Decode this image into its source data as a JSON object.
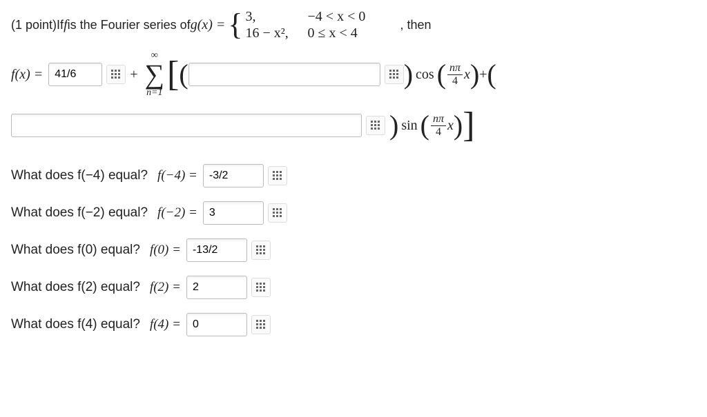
{
  "problem": {
    "points_label": "(1 point)",
    "intro_prefix": " If ",
    "f_sym": "f",
    "intro_mid": " is the Fourier series of ",
    "g_expr": "g(x) = ",
    "case1_val": "3,",
    "case1_cond": "−4 < x < 0",
    "case2_val": "16 − x²,",
    "case2_cond": "0 ≤ x < 4",
    "then_label": ", then"
  },
  "fourier": {
    "fx_equals": "f(x) =",
    "a0_value": "41/6",
    "plus": "+",
    "sum_top": "∞",
    "sum_bottom": "n=1",
    "cos_label": "cos",
    "sin_label": "sin",
    "frac_num": "nπ",
    "frac_den": "4",
    "x_sym": "x",
    "plus2": " + "
  },
  "questions": [
    {
      "label": "What does f(−4) equal?",
      "feq": "f(−4) = ",
      "value": "-3/2"
    },
    {
      "label": "What does f(−2) equal?",
      "feq": "f(−2) = ",
      "value": "3"
    },
    {
      "label": "What does f(0) equal?",
      "feq": "f(0) = ",
      "value": "-13/2"
    },
    {
      "label": "What does f(2) equal?",
      "feq": "f(2) = ",
      "value": "2"
    },
    {
      "label": "What does f(4) equal?",
      "feq": "f(4) = ",
      "value": "0"
    }
  ]
}
